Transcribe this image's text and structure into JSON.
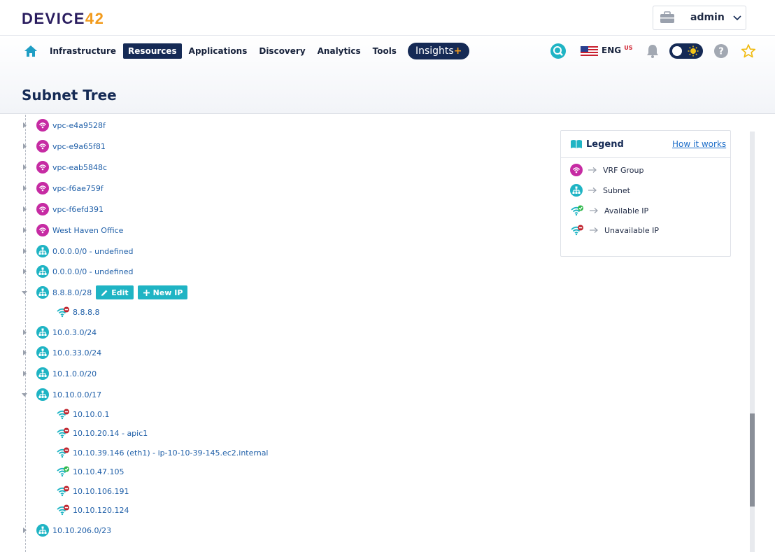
{
  "brand": {
    "logo_main": "DEVICE",
    "logo_accent": "42"
  },
  "user": {
    "name": "admin"
  },
  "nav": {
    "items": [
      {
        "label": "Infrastructure",
        "active": false
      },
      {
        "label": "Resources",
        "active": true
      },
      {
        "label": "Applications",
        "active": false
      },
      {
        "label": "Discovery",
        "active": false
      },
      {
        "label": "Analytics",
        "active": false
      },
      {
        "label": "Tools",
        "active": false
      }
    ],
    "insights_label": "Insights",
    "insights_plus": "+",
    "language": "ENG",
    "region": "US"
  },
  "page": {
    "title": "Subnet Tree"
  },
  "tree": {
    "rows": [
      {
        "type": "vrf",
        "label": "vpc-e4a9528f",
        "expanded": false
      },
      {
        "type": "vrf",
        "label": "vpc-e9a65f81",
        "expanded": false
      },
      {
        "type": "vrf",
        "label": "vpc-eab5848c",
        "expanded": false
      },
      {
        "type": "vrf",
        "label": "vpc-f6ae759f",
        "expanded": false
      },
      {
        "type": "vrf",
        "label": "vpc-f6efd391",
        "expanded": false
      },
      {
        "type": "vrf",
        "label": "West Haven Office",
        "expanded": false
      },
      {
        "type": "subnet",
        "label": "0.0.0.0/0 - undefined",
        "expanded": false
      },
      {
        "type": "subnet",
        "label": "0.0.0.0/0 - undefined",
        "expanded": false
      },
      {
        "type": "subnet",
        "label": "8.8.8.0/28",
        "expanded": true,
        "selected": true
      },
      {
        "type": "ip-unavailable",
        "label": "8.8.8.8"
      },
      {
        "type": "subnet",
        "label": "10.0.3.0/24",
        "expanded": false
      },
      {
        "type": "subnet",
        "label": "10.0.33.0/24",
        "expanded": false
      },
      {
        "type": "subnet",
        "label": "10.1.0.0/20",
        "expanded": false
      },
      {
        "type": "subnet",
        "label": "10.10.0.0/17",
        "expanded": true
      },
      {
        "type": "ip-unavailable",
        "label": "10.10.0.1"
      },
      {
        "type": "ip-unavailable",
        "label": "10.10.20.14 - apic1"
      },
      {
        "type": "ip-unavailable",
        "label": "10.10.39.146 (eth1) - ip-10-10-39-145.ec2.internal"
      },
      {
        "type": "ip-available",
        "label": "10.10.47.105"
      },
      {
        "type": "ip-unavailable",
        "label": "10.10.106.191"
      },
      {
        "type": "ip-unavailable",
        "label": "10.10.120.124"
      },
      {
        "type": "subnet",
        "label": "10.10.206.0/23",
        "expanded": false
      }
    ],
    "edit_label": "Edit",
    "new_ip_label": "New IP"
  },
  "legend": {
    "title": "Legend",
    "how_link": "How it works",
    "items": [
      {
        "icon": "vrf-group-icon",
        "label": "VRF Group"
      },
      {
        "icon": "subnet-icon",
        "label": "Subnet"
      },
      {
        "icon": "available-ip-icon",
        "label": "Available IP"
      },
      {
        "icon": "unavailable-ip-icon",
        "label": "Unavailable IP"
      }
    ]
  },
  "colors": {
    "navy": "#152a55",
    "teal": "#1fb4c4",
    "vrf_magenta": "#c62ba3",
    "link_blue": "#1f5fa8",
    "available_green": "#2eb84a",
    "unavailable_red": "#c0242e",
    "accent_orange": "#f29b1d"
  }
}
